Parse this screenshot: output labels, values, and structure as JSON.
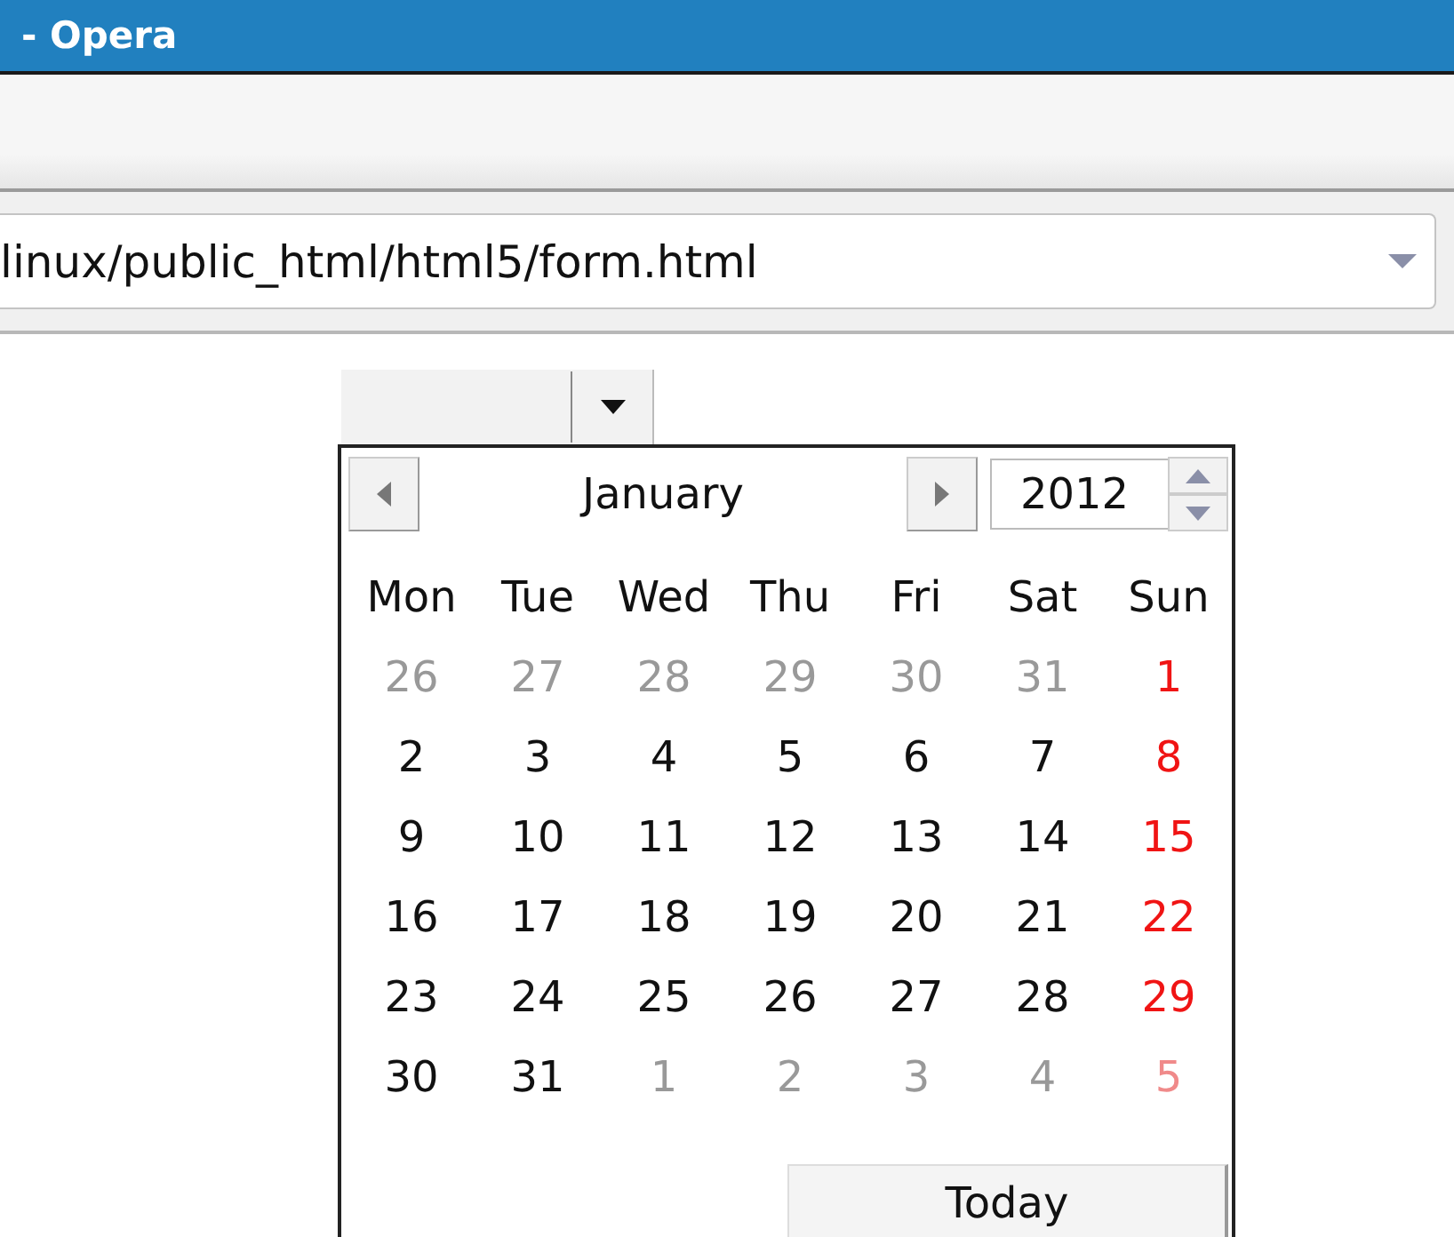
{
  "window": {
    "title": "- Opera"
  },
  "address_bar": {
    "value": "linux/public_html/html5/form.html"
  },
  "date_picker": {
    "month": "January",
    "year": "2012",
    "weekdays": [
      "Mon",
      "Tue",
      "Wed",
      "Thu",
      "Fri",
      "Sat",
      "Sun"
    ],
    "weeks": [
      [
        {
          "day": "26",
          "other_month": true,
          "holiday": false
        },
        {
          "day": "27",
          "other_month": true,
          "holiday": false
        },
        {
          "day": "28",
          "other_month": true,
          "holiday": false
        },
        {
          "day": "29",
          "other_month": true,
          "holiday": false
        },
        {
          "day": "30",
          "other_month": true,
          "holiday": false
        },
        {
          "day": "31",
          "other_month": true,
          "holiday": false
        },
        {
          "day": "1",
          "other_month": false,
          "holiday": true
        }
      ],
      [
        {
          "day": "2",
          "other_month": false,
          "holiday": false
        },
        {
          "day": "3",
          "other_month": false,
          "holiday": false
        },
        {
          "day": "4",
          "other_month": false,
          "holiday": false
        },
        {
          "day": "5",
          "other_month": false,
          "holiday": false
        },
        {
          "day": "6",
          "other_month": false,
          "holiday": false
        },
        {
          "day": "7",
          "other_month": false,
          "holiday": false
        },
        {
          "day": "8",
          "other_month": false,
          "holiday": true
        }
      ],
      [
        {
          "day": "9",
          "other_month": false,
          "holiday": false
        },
        {
          "day": "10",
          "other_month": false,
          "holiday": false
        },
        {
          "day": "11",
          "other_month": false,
          "holiday": false
        },
        {
          "day": "12",
          "other_month": false,
          "holiday": false
        },
        {
          "day": "13",
          "other_month": false,
          "holiday": false
        },
        {
          "day": "14",
          "other_month": false,
          "holiday": false
        },
        {
          "day": "15",
          "other_month": false,
          "holiday": true
        }
      ],
      [
        {
          "day": "16",
          "other_month": false,
          "holiday": false
        },
        {
          "day": "17",
          "other_month": false,
          "holiday": false
        },
        {
          "day": "18",
          "other_month": false,
          "holiday": false
        },
        {
          "day": "19",
          "other_month": false,
          "holiday": false
        },
        {
          "day": "20",
          "other_month": false,
          "holiday": false
        },
        {
          "day": "21",
          "other_month": false,
          "holiday": false
        },
        {
          "day": "22",
          "other_month": false,
          "holiday": true
        }
      ],
      [
        {
          "day": "23",
          "other_month": false,
          "holiday": false
        },
        {
          "day": "24",
          "other_month": false,
          "holiday": false
        },
        {
          "day": "25",
          "other_month": false,
          "holiday": false
        },
        {
          "day": "26",
          "other_month": false,
          "holiday": false
        },
        {
          "day": "27",
          "other_month": false,
          "holiday": false
        },
        {
          "day": "28",
          "other_month": false,
          "holiday": false
        },
        {
          "day": "29",
          "other_month": false,
          "holiday": true
        }
      ],
      [
        {
          "day": "30",
          "other_month": false,
          "holiday": false
        },
        {
          "day": "31",
          "other_month": false,
          "holiday": false
        },
        {
          "day": "1",
          "other_month": true,
          "holiday": false
        },
        {
          "day": "2",
          "other_month": true,
          "holiday": false
        },
        {
          "day": "3",
          "other_month": true,
          "holiday": false
        },
        {
          "day": "4",
          "other_month": true,
          "holiday": false
        },
        {
          "day": "5",
          "other_month": true,
          "holiday": true
        }
      ]
    ],
    "today_button": "Today"
  }
}
